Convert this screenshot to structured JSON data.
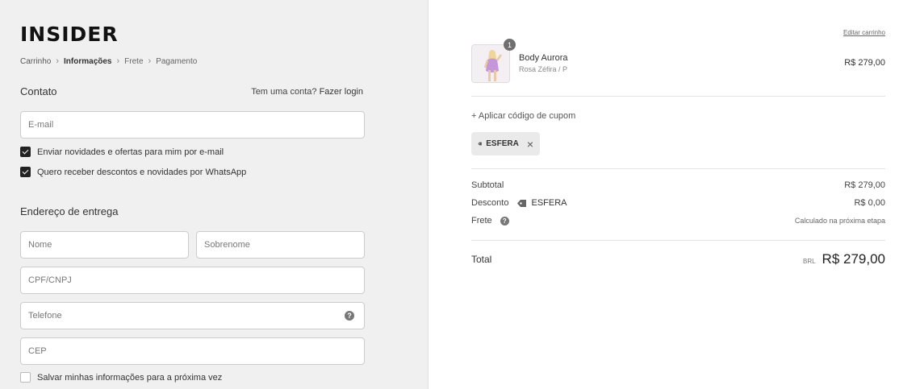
{
  "brand": {
    "logo_text": "INSIDER"
  },
  "breadcrumb": {
    "items": [
      {
        "label": "Carrinho",
        "state": "link"
      },
      {
        "label": "Informações",
        "state": "current"
      },
      {
        "label": "Frete",
        "state": "pending"
      },
      {
        "label": "Pagamento",
        "state": "pending"
      }
    ]
  },
  "contact": {
    "title": "Contato",
    "login_prompt": "Tem uma conta?",
    "login_link": "Fazer login",
    "email_placeholder": "E-mail",
    "checkboxes": [
      {
        "label": "Enviar novidades e ofertas para mim por e-mail",
        "checked": true
      },
      {
        "label": "Quero receber descontos e novidades por WhatsApp",
        "checked": true
      }
    ]
  },
  "shipping": {
    "title": "Endereço de entrega",
    "first_name_placeholder": "Nome",
    "last_name_placeholder": "Sobrenome",
    "cpf_placeholder": "CPF/CNPJ",
    "phone_placeholder": "Telefone",
    "cep_placeholder": "CEP",
    "save_info_label": "Salvar minhas informações para a próxima vez",
    "save_info_checked": false
  },
  "cart": {
    "edit_link": "Editar carrinho",
    "item": {
      "name": "Body Aurora",
      "variant": "Rosa Zéfira / P",
      "price": "R$ 279,00",
      "quantity": "1"
    },
    "coupon_link": "+ Aplicar código de cupom",
    "applied_coupon": "ESFERA"
  },
  "summary": {
    "subtotal_label": "Subtotal",
    "subtotal_value": "R$ 279,00",
    "discount_label": "Desconto",
    "discount_code": "ESFERA",
    "discount_value": "R$ 0,00",
    "shipping_label": "Frete",
    "shipping_value": "Calculado na próxima etapa",
    "total_label": "Total",
    "currency": "BRL",
    "total_value": "R$ 279,00"
  },
  "colors": {
    "left_bg": "#f0f0f0",
    "accent_dark": "#222222",
    "chip_bg": "#eaeaea"
  }
}
